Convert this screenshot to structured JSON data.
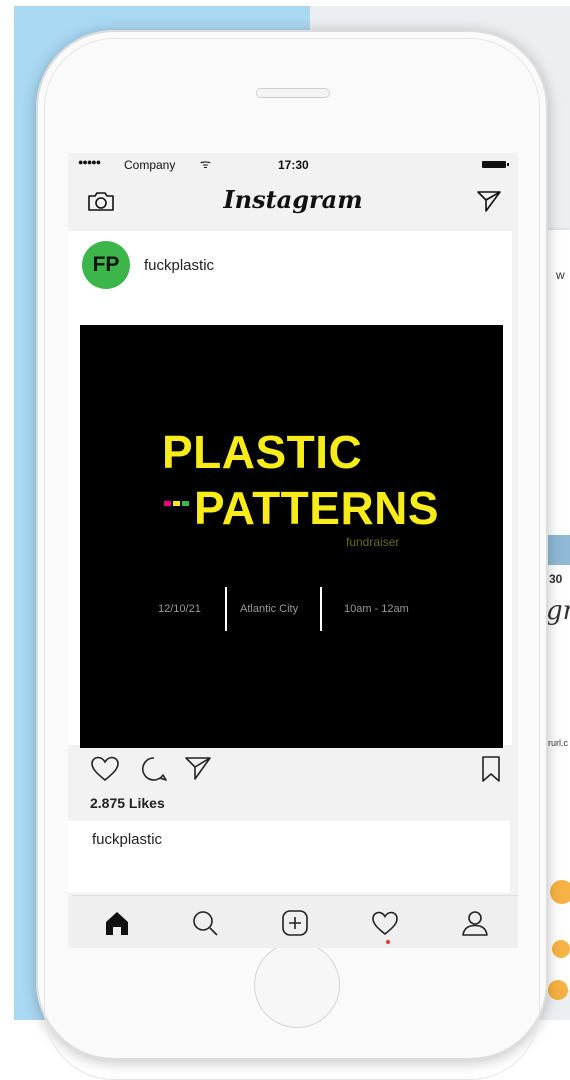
{
  "statusbar": {
    "signal": "●●●●●",
    "carrier": "Company",
    "wifi": "ᯤ",
    "time": "17:30"
  },
  "navbar": {
    "logo": "Instagram"
  },
  "post": {
    "avatar_initials": "FP",
    "username": "fuckplastic",
    "image": {
      "title_line1": "PLASTIC",
      "title_line2": "PATTERNS",
      "subtitle": "fundraiser",
      "date": "12/10/21",
      "location": "Atlantic City",
      "time": "10am - 12am",
      "title_color": "#f7ec1a",
      "dot_colors": [
        "#e6007e",
        "#f7ec1a",
        "#3cb54a"
      ]
    },
    "likes": "2.875 Likes",
    "caption_user": "fuckplastic"
  },
  "background": {
    "side_text_1": "w",
    "side_text_2": "30",
    "side_script": "gr",
    "side_text_3": "rurl.c"
  },
  "icons": [
    "camera-icon",
    "send-icon",
    "heart-icon",
    "comment-icon",
    "share-icon",
    "bookmark-icon",
    "home-icon",
    "search-icon",
    "add-icon",
    "activity-icon",
    "profile-icon"
  ],
  "colors": {
    "avatar": "#3cb54a",
    "notification_dot": "#e53935",
    "background_blue": "#a9d8f3"
  }
}
